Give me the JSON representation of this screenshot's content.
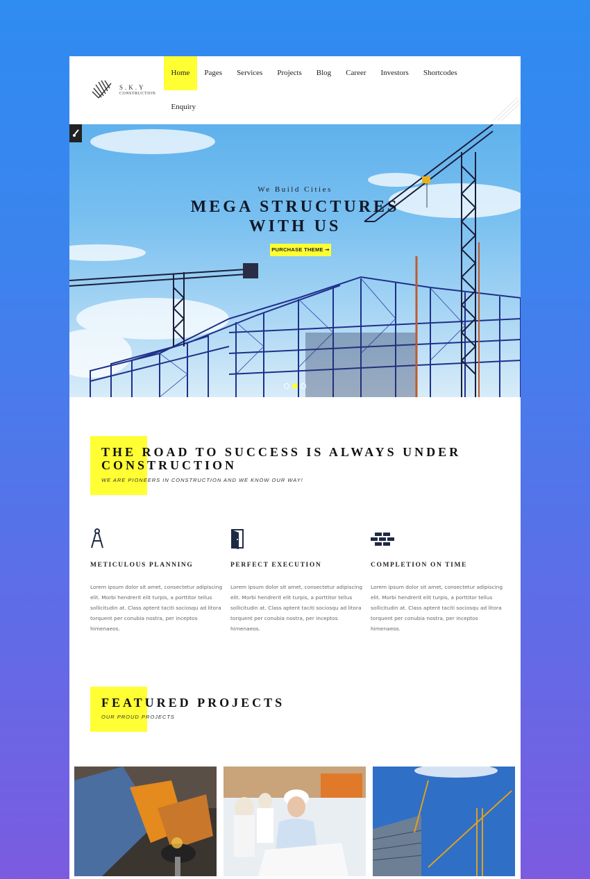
{
  "brand": {
    "name_line1": "S.K.Y",
    "name_line2": "CONSTRUCTION"
  },
  "nav": {
    "items": [
      "Home",
      "Pages",
      "Services",
      "Projects",
      "Blog",
      "Career",
      "Investors",
      "Shortcodes",
      "Enquiry"
    ],
    "active": "Home"
  },
  "hero": {
    "subtitle": "We Build Cities",
    "title_line1": "MEGA STRUCTURES",
    "title_line2": "WITH US",
    "button_label": "PURCHASE THEME ➞",
    "slides": 3,
    "active_slide": 2
  },
  "intro": {
    "title": "THE ROAD TO SUCCESS IS ALWAYS UNDER CONSTRUCTION",
    "subtitle": "WE ARE PIONEERS IN CONSTRUCTION AND WE KNOW OUR WAY!"
  },
  "features": [
    {
      "icon": "compass-icon",
      "title": "METICULOUS PLANNING",
      "text": "Lorem ipsum dolor sit amet, consectetur adipiscing elit. Morbi hendrerit elit turpis, a porttitor tellus sollicitudin at. Class aptent taciti sociosqu ad litora torquent per conubia nostra, per inceptos himenaeos."
    },
    {
      "icon": "door-icon",
      "title": "PERFECT EXECUTION",
      "text": "Lorem ipsum dolor sit amet, consectetur adipiscing elit. Morbi hendrerit elit turpis, a porttitor tellus sollicitudin at. Class aptent taciti sociosqu ad litora torquent per conubia nostra, per inceptos himenaeos."
    },
    {
      "icon": "bricks-icon",
      "title": "COMPLETION ON TIME",
      "text": "Lorem ipsum dolor sit amet, consectetur adipiscing elit. Morbi hendrerit elit turpis, a porttitor tellus sollicitudin at. Class aptent taciti sociosqu ad litora torquent per conubia nostra, per inceptos himenaeos."
    }
  ],
  "featured": {
    "title": "FEATURED PROJECTS",
    "subtitle": "OUR PROUD PROJECTS"
  },
  "colors": {
    "accent": "#ffff33",
    "text_dark": "#111111",
    "background_gradient_top": "#2f8cf0",
    "background_gradient_bottom": "#7b5be0"
  }
}
